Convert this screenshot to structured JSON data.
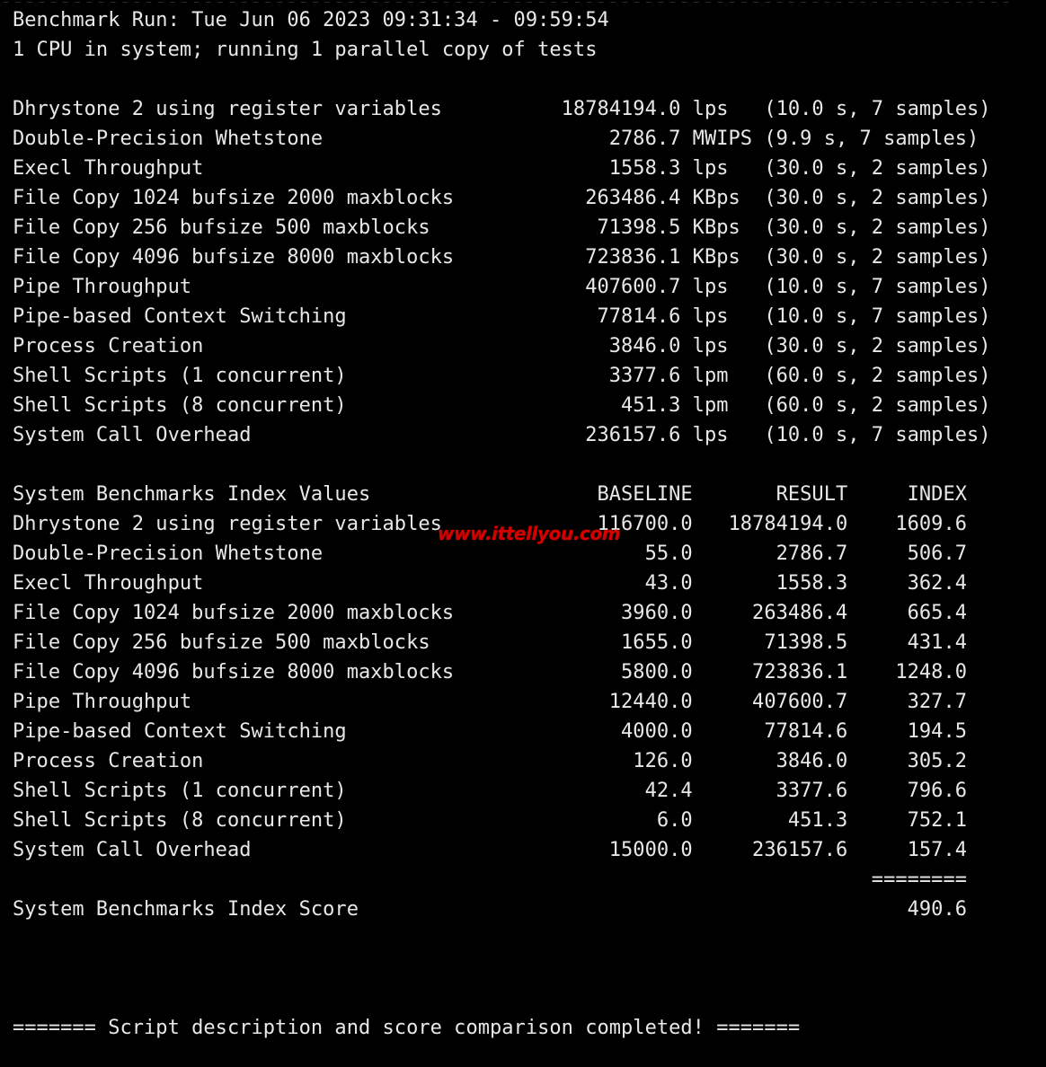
{
  "terminal": {
    "background_color": "#000000",
    "text_color": "#e8e8e8",
    "watermark_color": "#d40000",
    "top_rule": "-------------------------------------------------------------------------------------"
  },
  "header": {
    "run_line": "Benchmark Run: Tue Jun 06 2023 09:31:34 - 09:59:54",
    "cpu_line": "1 CPU in system; running 1 parallel copy of tests"
  },
  "results": {
    "rows": [
      {
        "name": "Dhrystone 2 using register variables",
        "value": "18784194.0",
        "unit": "lps",
        "duration": "10.0",
        "samples": "7"
      },
      {
        "name": "Double-Precision Whetstone",
        "value": "2786.7",
        "unit": "MWIPS",
        "duration": "9.9",
        "samples": "7"
      },
      {
        "name": "Execl Throughput",
        "value": "1558.3",
        "unit": "lps",
        "duration": "30.0",
        "samples": "2"
      },
      {
        "name": "File Copy 1024 bufsize 2000 maxblocks",
        "value": "263486.4",
        "unit": "KBps",
        "duration": "30.0",
        "samples": "2"
      },
      {
        "name": "File Copy 256 bufsize 500 maxblocks",
        "value": "71398.5",
        "unit": "KBps",
        "duration": "30.0",
        "samples": "2"
      },
      {
        "name": "File Copy 4096 bufsize 8000 maxblocks",
        "value": "723836.1",
        "unit": "KBps",
        "duration": "30.0",
        "samples": "2"
      },
      {
        "name": "Pipe Throughput",
        "value": "407600.7",
        "unit": "lps",
        "duration": "10.0",
        "samples": "7"
      },
      {
        "name": "Pipe-based Context Switching",
        "value": "77814.6",
        "unit": "lps",
        "duration": "10.0",
        "samples": "7"
      },
      {
        "name": "Process Creation",
        "value": "3846.0",
        "unit": "lps",
        "duration": "30.0",
        "samples": "2"
      },
      {
        "name": "Shell Scripts (1 concurrent)",
        "value": "3377.6",
        "unit": "lpm",
        "duration": "60.0",
        "samples": "2"
      },
      {
        "name": "Shell Scripts (8 concurrent)",
        "value": "451.3",
        "unit": "lpm",
        "duration": "60.0",
        "samples": "2"
      },
      {
        "name": "System Call Overhead",
        "value": "236157.6",
        "unit": "lps",
        "duration": "10.0",
        "samples": "7"
      }
    ]
  },
  "index_table": {
    "title": "System Benchmarks Index Values",
    "columns": [
      "BASELINE",
      "RESULT",
      "INDEX"
    ],
    "rows": [
      {
        "name": "Dhrystone 2 using register variables",
        "baseline": "116700.0",
        "result": "18784194.0",
        "index": "1609.6"
      },
      {
        "name": "Double-Precision Whetstone",
        "baseline": "55.0",
        "result": "2786.7",
        "index": "506.7"
      },
      {
        "name": "Execl Throughput",
        "baseline": "43.0",
        "result": "1558.3",
        "index": "362.4"
      },
      {
        "name": "File Copy 1024 bufsize 2000 maxblocks",
        "baseline": "3960.0",
        "result": "263486.4",
        "index": "665.4"
      },
      {
        "name": "File Copy 256 bufsize 500 maxblocks",
        "baseline": "1655.0",
        "result": "71398.5",
        "index": "431.4"
      },
      {
        "name": "File Copy 4096 bufsize 8000 maxblocks",
        "baseline": "5800.0",
        "result": "723836.1",
        "index": "1248.0"
      },
      {
        "name": "Pipe Throughput",
        "baseline": "12440.0",
        "result": "407600.7",
        "index": "327.7"
      },
      {
        "name": "Pipe-based Context Switching",
        "baseline": "4000.0",
        "result": "77814.6",
        "index": "194.5"
      },
      {
        "name": "Process Creation",
        "baseline": "126.0",
        "result": "3846.0",
        "index": "305.2"
      },
      {
        "name": "Shell Scripts (1 concurrent)",
        "baseline": "42.4",
        "result": "3377.6",
        "index": "796.6"
      },
      {
        "name": "Shell Scripts (8 concurrent)",
        "baseline": "6.0",
        "result": "451.3",
        "index": "752.1"
      },
      {
        "name": "System Call Overhead",
        "baseline": "15000.0",
        "result": "236157.6",
        "index": "157.4"
      }
    ],
    "separator": "========",
    "score_label": "System Benchmarks Index Score",
    "score_value": "490.6"
  },
  "footer": {
    "completed_line": "======= Script description and score comparison completed! ======="
  },
  "watermark": {
    "text": "www.ittellyou.com"
  }
}
